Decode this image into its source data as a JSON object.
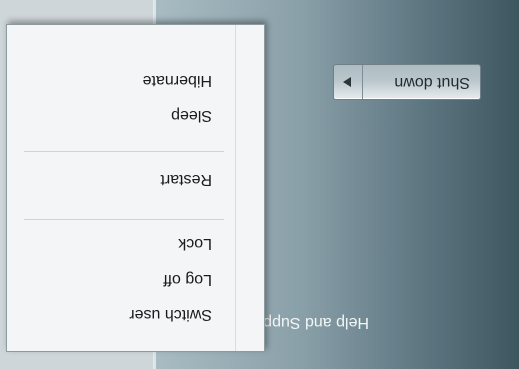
{
  "start_menu": {
    "help_and_support": "Help and Support",
    "shutdown_button": {
      "label": "Shut down",
      "arrow_icon": "triangle-right-icon"
    },
    "power_menu": {
      "items": [
        {
          "label": "Switch user"
        },
        {
          "label": "Log off"
        },
        {
          "label": "Lock"
        },
        {
          "label": "Restart"
        },
        {
          "label": "Sleep"
        },
        {
          "label": "Hibernate"
        }
      ]
    }
  }
}
